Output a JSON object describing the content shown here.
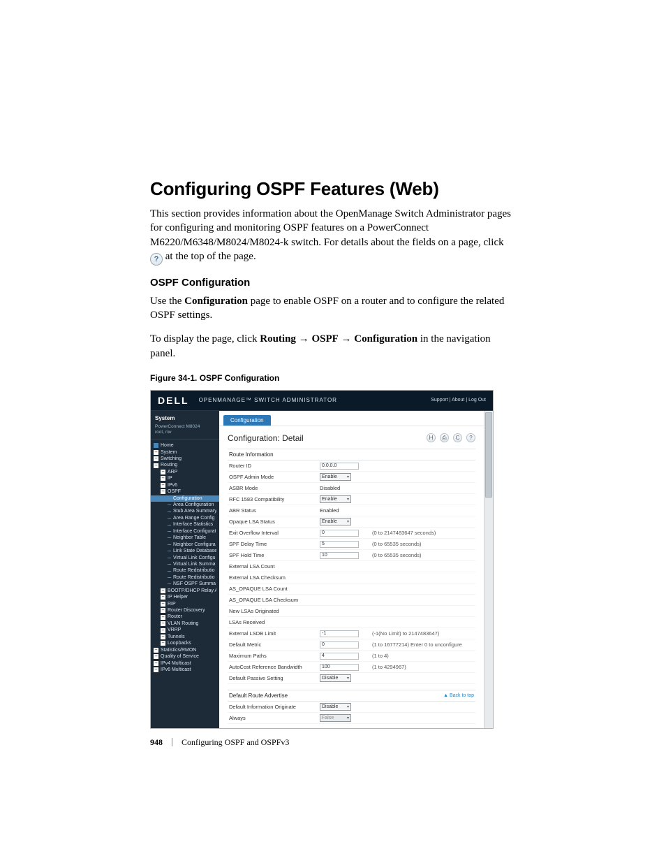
{
  "heading": "Configuring OSPF Features (Web)",
  "intro_part1": "This section provides information about the OpenManage Switch Administrator pages for configuring and monitoring OSPF features on a PowerConnect M6220/M6348/M8024/M8024-k switch. For details about the fields on a page, click ",
  "intro_part2": " at the top of the page.",
  "section_heading": "OSPF Configuration",
  "para2_a": "Use the ",
  "para2_b": "Configuration",
  "para2_c": " page to enable OSPF on a router and to configure the related OSPF settings.",
  "para3_a": "To display the page, click ",
  "para3_b": "Routing",
  "para3_c": "OSPF",
  "para3_d": "Configuration",
  "para3_e": " in the navigation panel.",
  "fig_caption": "Figure 34-1.    OSPF Configuration",
  "footer_page": "948",
  "footer_title": "Configuring OSPF and OSPFv3",
  "help_glyph": "?",
  "arrow": "→",
  "mock": {
    "logo": "DELL",
    "app": "OPENMANAGE™ SWITCH ADMINISTRATOR",
    "top_links": "Support  |  About  |  Log Out",
    "nav_system": "System",
    "nav_model": "PowerConnect M8024",
    "nav_user": "root, r/w",
    "nav": [
      "Home",
      "System",
      "Switching",
      "Routing",
      "ARP",
      "IP",
      "IPv6",
      "OSPF",
      "Configuration",
      "Area Configuration",
      "Stub Area Summary",
      "Area Range Config",
      "Interface Statistics",
      "Interface Configurat",
      "Neighbor Table",
      "Neighbor Configura",
      "Link State Database",
      "Virtual Link Configu",
      "Virtual Link Summa",
      "Route Redistributio",
      "Route Redistributio",
      "NSF OSPF Summa",
      "BOOTP/DHCP Relay Age",
      "IP Helper",
      "RIP",
      "Router Discovery",
      "Router",
      "VLAN Routing",
      "VRRP",
      "Tunnels",
      "Loopbacks",
      "Statistics/RMON",
      "Quality of Service",
      "IPv4 Multicast",
      "IPv6 Multicast"
    ],
    "tab": "Configuration",
    "content_title": "Configuration: Detail",
    "section1": "Route Information",
    "section2": "Default Route Advertise",
    "back_to_top": "▲ Back to top",
    "rows": [
      {
        "label": "Router ID",
        "ctrl": "input",
        "val": "0.0.0.0",
        "hint": ""
      },
      {
        "label": "OSPF Admin Mode",
        "ctrl": "select",
        "val": "Enable",
        "hint": ""
      },
      {
        "label": "ASBR Mode",
        "ctrl": "text",
        "val": "Disabled",
        "hint": ""
      },
      {
        "label": "RFC 1583 Compatibility",
        "ctrl": "select",
        "val": "Enable",
        "hint": ""
      },
      {
        "label": "ABR Status",
        "ctrl": "text",
        "val": "Enabled",
        "hint": ""
      },
      {
        "label": "Opaque LSA Status",
        "ctrl": "select",
        "val": "Enable",
        "hint": ""
      },
      {
        "label": "Exit Overflow Interval",
        "ctrl": "input",
        "val": "0",
        "hint": "(0 to 2147483647 seconds)"
      },
      {
        "label": "SPF Delay Time",
        "ctrl": "input",
        "val": "5",
        "hint": "(0 to 65535 seconds)"
      },
      {
        "label": "SPF Hold Time",
        "ctrl": "input",
        "val": "10",
        "hint": "(0 to 65535 seconds)"
      },
      {
        "label": "External LSA Count",
        "ctrl": "text",
        "val": "",
        "hint": ""
      },
      {
        "label": "External LSA Checksum",
        "ctrl": "text",
        "val": "",
        "hint": ""
      },
      {
        "label": "AS_OPAQUE LSA Count",
        "ctrl": "text",
        "val": "",
        "hint": ""
      },
      {
        "label": "AS_OPAQUE LSA Checksum",
        "ctrl": "text",
        "val": "",
        "hint": ""
      },
      {
        "label": "New LSAs Originated",
        "ctrl": "text",
        "val": "",
        "hint": ""
      },
      {
        "label": "LSAs Received",
        "ctrl": "text",
        "val": "",
        "hint": ""
      },
      {
        "label": "External LSDB Limit",
        "ctrl": "input",
        "val": "-1",
        "hint": "(-1(No Limit) to 2147483647)"
      },
      {
        "label": "Default Metric",
        "ctrl": "input",
        "val": "0",
        "hint": "(1 to 16777214) Enter 0 to unconfigure"
      },
      {
        "label": "Maximum Paths",
        "ctrl": "input",
        "val": "4",
        "hint": "(1 to 4)"
      },
      {
        "label": "AutoCost Reference Bandwidth",
        "ctrl": "input",
        "val": "100",
        "hint": "(1 to 4294967)"
      },
      {
        "label": "Default Passive Setting",
        "ctrl": "select",
        "val": "Disable",
        "hint": ""
      }
    ],
    "rows2": [
      {
        "label": "Default Information Originate",
        "ctrl": "select",
        "val": "Disable",
        "hint": ""
      },
      {
        "label": "Always",
        "ctrl": "select-disabled",
        "val": "False",
        "hint": ""
      }
    ]
  }
}
